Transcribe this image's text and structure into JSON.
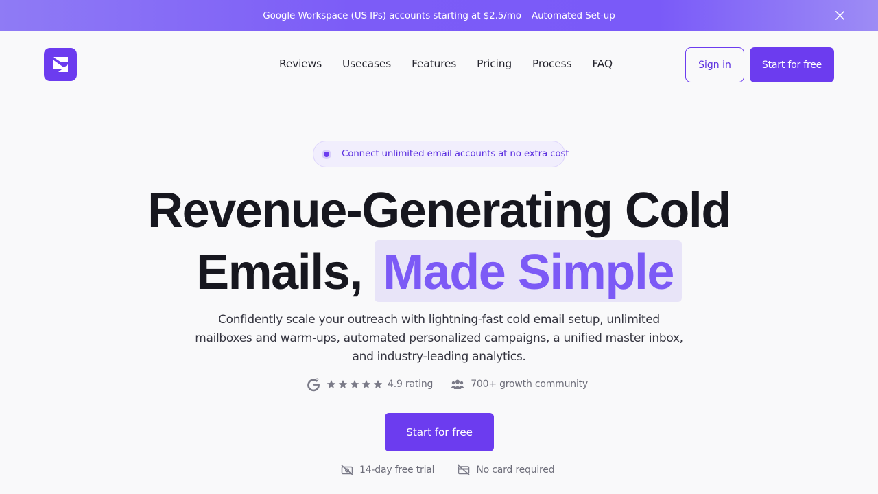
{
  "banner": {
    "text": "Google Workspace (US IPs) accounts starting at $2.5/mo – Automated Set-up",
    "close_icon": "close-icon"
  },
  "nav": {
    "logo_icon": "brand-logo-icon",
    "links": [
      "Reviews",
      "Usecases",
      "Features",
      "Pricing",
      "Process",
      "FAQ"
    ],
    "sign_in": "Sign in",
    "start": "Start for free"
  },
  "hero": {
    "pill": "Connect unlimited email accounts at no extra cost",
    "headline_line1": "Revenue-Generating Cold",
    "headline_line2_plain": "Emails,",
    "headline_line2_highlight": "Made Simple",
    "subtext": "Confidently scale your outreach with lightning-fast cold email setup, unlimited mailboxes and warm-ups, automated personalized campaigns, a unified master inbox, and industry-leading analytics.",
    "rating_stars": 5,
    "rating": "4.9 rating",
    "community": "700+ growth community",
    "cta": "Start for free",
    "perk1": "14-day free trial",
    "perk2": "No card required"
  },
  "colors": {
    "accent": "#6c3cef",
    "highlight_text": "#7c5af6",
    "highlight_bg": "#e8e4f8",
    "banner_gradient_start": "#8f7bf5",
    "banner_gradient_end": "#9d8cf5"
  },
  "icons": [
    "close-icon",
    "brand-logo-icon",
    "g2-icon",
    "star-icon",
    "people-icon",
    "no-camera-icon",
    "no-card-icon"
  ]
}
